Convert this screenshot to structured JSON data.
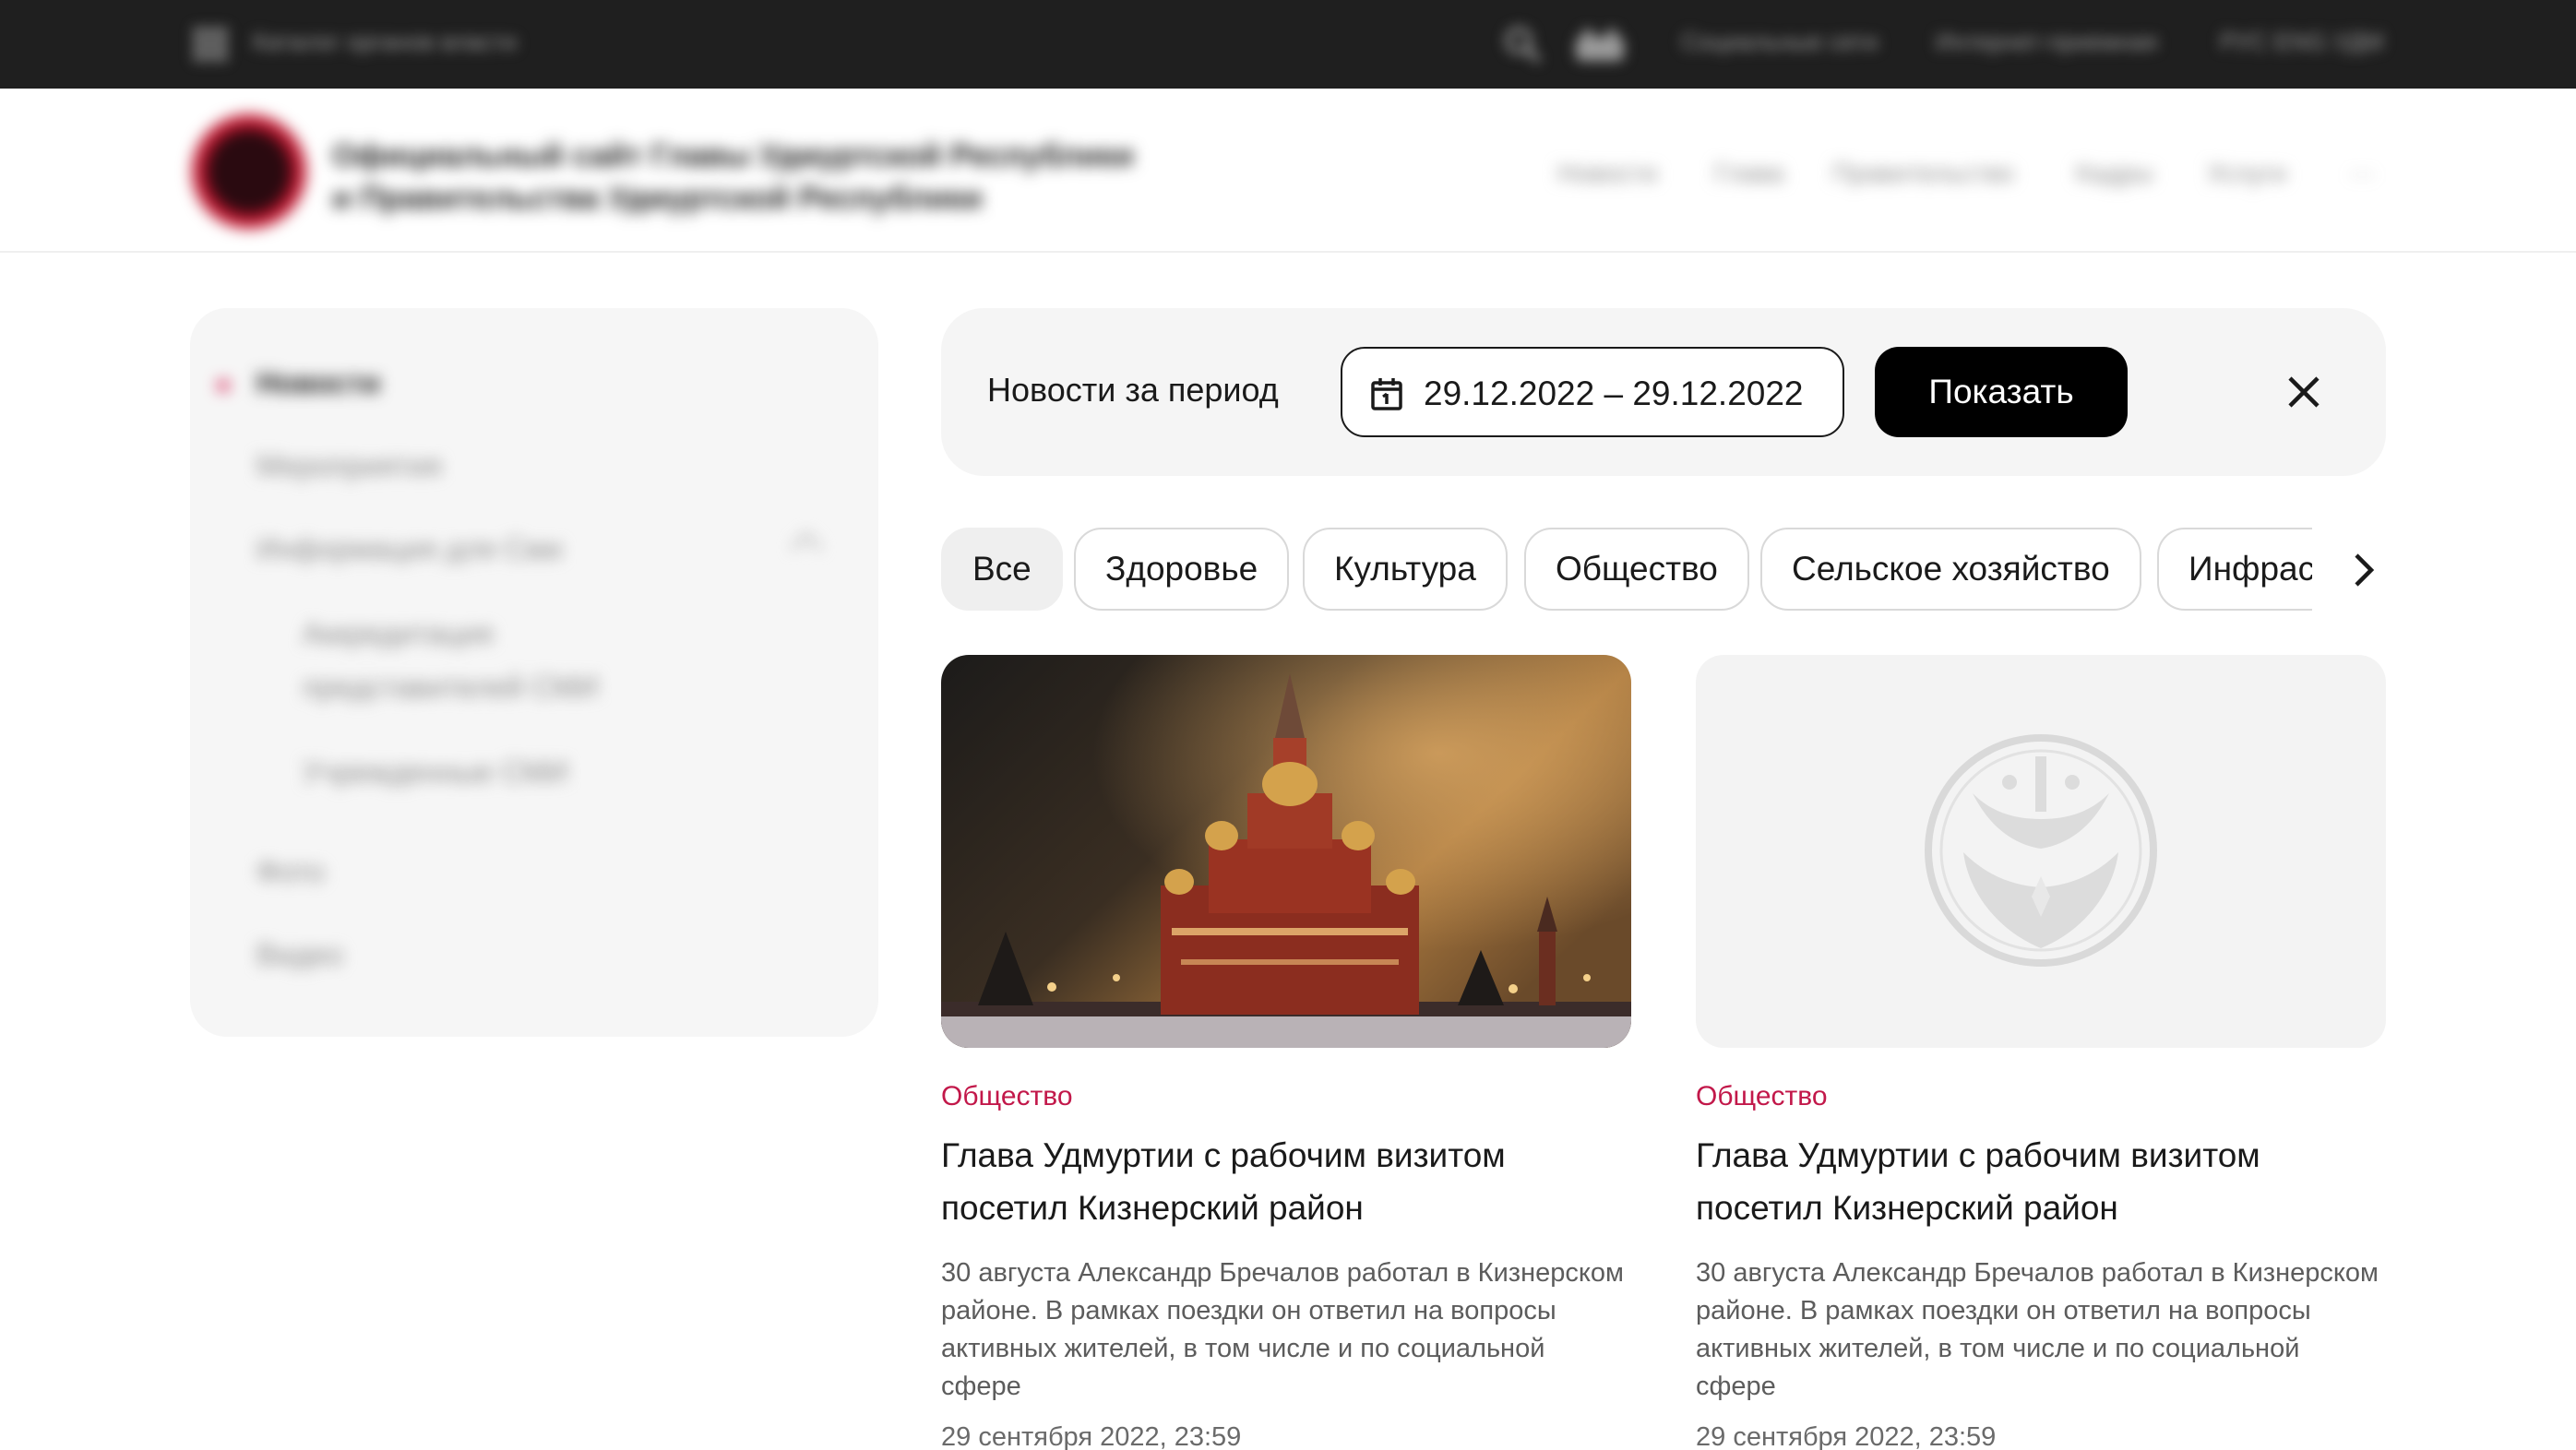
{
  "topbar": {
    "left_text": "Каталог органов власти",
    "links": [
      "Социальные сети",
      "Интернет-приемная",
      "РУС ENG УДМ"
    ],
    "icons": [
      "apps-grid-icon",
      "search-icon",
      "accessibility-eye-icon"
    ]
  },
  "header": {
    "title_line1": "Официальный сайт Главы Удмуртской Республики",
    "title_line2": "и Правительства Удмуртской Республики",
    "nav": [
      "Новости",
      "Глава",
      "Правительство",
      "Кадры",
      "Услуги",
      "···"
    ]
  },
  "sidebar": {
    "items": [
      {
        "label": "Новости",
        "active": true
      },
      {
        "label": "Мероприятия"
      },
      {
        "label": "Информация для Сми"
      },
      {
        "label": "Аккредитация"
      },
      {
        "label": "представителей СМИ"
      },
      {
        "label": "Учрежденные СМИ"
      },
      {
        "label": "Фото"
      },
      {
        "label": "Видео"
      }
    ]
  },
  "filter": {
    "label": "Новости за период",
    "date_range": "29.12.2022 – 29.12.2022",
    "show_button": "Показать"
  },
  "tabs": [
    "Все",
    "Здоровье",
    "Культура",
    "Общество",
    "Сельское хозяйство",
    "Инфрас"
  ],
  "cards": [
    {
      "category": "Общество",
      "title": "Глава Удмуртии с рабочим визитом посетил Кизнерский район",
      "text": "30 августа Александр Бречалов работал в Кизнерском районе. В рамках поездки он ответил на вопросы активных жителей, в том числе и по социальной сфере",
      "date": "29 сентября 2022, 23:59",
      "image": "cathedral-night-photo"
    },
    {
      "category": "Общество",
      "title": "Глава Удмуртии с рабочим визитом посетил Кизнерский район",
      "text": "30 августа Александр Бречалов работал в Кизнерском районе. В рамках поездки он ответил на вопросы активных жителей, в том числе и по социальной сфере",
      "date": "29 сентября 2022, 23:59",
      "image": "emblem-placeholder-icon"
    }
  ],
  "colors": {
    "accent": "#c2184a",
    "topbar": "#1f1f1f",
    "button": "#000000",
    "panel": "#f5f5f5"
  }
}
